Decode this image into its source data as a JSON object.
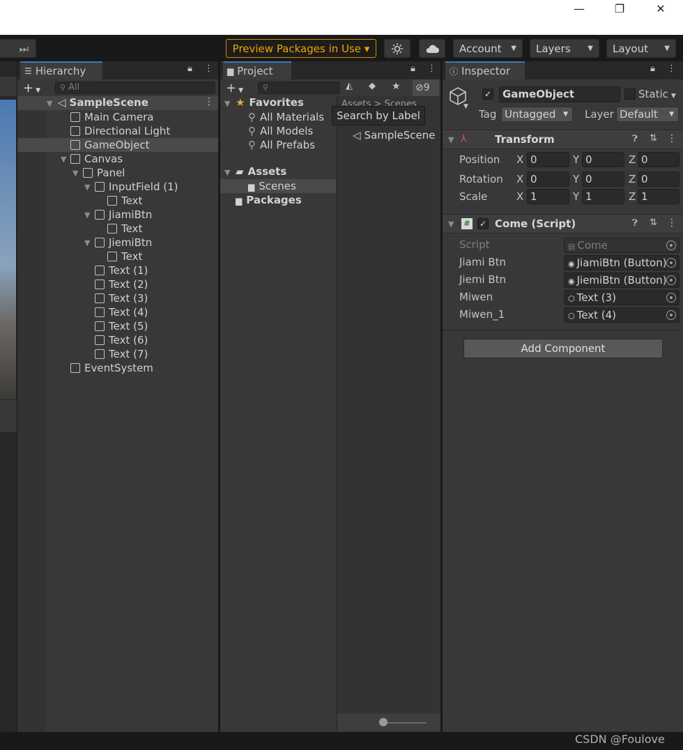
{
  "window": {
    "minimize": "—",
    "restore": "❐",
    "close": "✕"
  },
  "toolbar": {
    "step": "⏭",
    "preview": "Preview Packages in Use ▾",
    "account": "Account",
    "layers": "Layers",
    "layout": "Layout",
    "caret": "▼"
  },
  "hierarchy": {
    "tab": "Hierarchy",
    "search_placeholder": "All",
    "add": "+",
    "scene": "SampleScene",
    "nodes": [
      "Main Camera",
      "Directional Light",
      "GameObject",
      "Canvas",
      "Panel",
      "InputField (1)",
      "Text",
      "JiamiBtn",
      "Text",
      "JiemiBtn",
      "Text",
      "Text (1)",
      "Text (2)",
      "Text (3)",
      "Text (4)",
      "Text (5)",
      "Text (6)",
      "Text (7)",
      "EventSystem"
    ]
  },
  "project": {
    "tab": "Project",
    "add": "+",
    "hidden_count": "9",
    "favorites": "Favorites",
    "fav_items": [
      "All Materials",
      "All Models",
      "All Prefabs"
    ],
    "assets": "Assets",
    "scenes": "Scenes",
    "packages": "Packages",
    "breadcrumb": "Assets > Scenes",
    "tooltip": "Search by Label",
    "scene_file": "SampleScene"
  },
  "inspector": {
    "tab": "Inspector",
    "object_name": "GameObject",
    "static": "Static",
    "tag_label": "Tag",
    "tag": "Untagged",
    "layer_label": "Layer",
    "layer": "Default",
    "transform": {
      "title": "Transform",
      "rows": [
        {
          "label": "Position",
          "x": "0",
          "y": "0",
          "z": "0"
        },
        {
          "label": "Rotation",
          "x": "0",
          "y": "0",
          "z": "0"
        },
        {
          "label": "Scale",
          "x": "1",
          "y": "1",
          "z": "1"
        }
      ],
      "axis": [
        "X",
        "Y",
        "Z"
      ]
    },
    "script_comp": {
      "title": "Come (Script)",
      "fields": [
        {
          "label": "Script",
          "value": "Come"
        },
        {
          "label": "Jiami Btn",
          "value": "JiamiBtn (Button)"
        },
        {
          "label": "Jiemi Btn",
          "value": "JiemiBtn (Button)"
        },
        {
          "label": "Miwen",
          "value": "Text (3)"
        },
        {
          "label": "Miwen_1",
          "value": "Text (4)"
        }
      ]
    },
    "add_component": "Add Component"
  },
  "watermark": "CSDN @Foulove",
  "colors": {
    "accent": "#3a79bb",
    "preview": "#f0a500"
  }
}
